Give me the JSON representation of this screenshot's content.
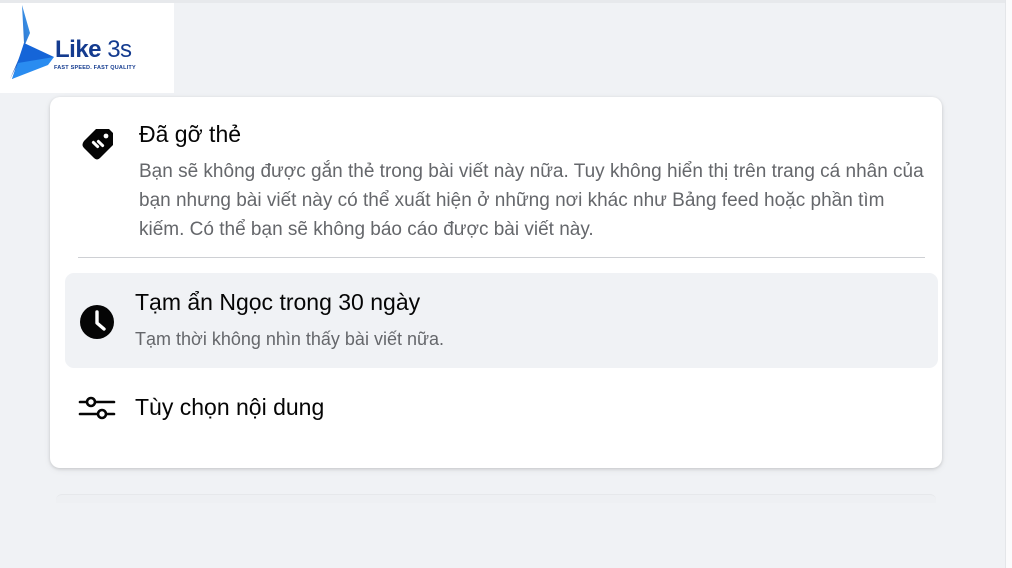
{
  "logo": {
    "wordmark": "Like",
    "wordmark_number": "3s",
    "tagline": "FAST SPEED. FAST QUALITY",
    "colors": {
      "primary": "#143b8f",
      "accent": "#1e88e5"
    }
  },
  "menu": {
    "items": [
      {
        "icon": "tag-removed-icon",
        "title": "Đã gỡ thẻ",
        "description": "Bạn sẽ không được gắn thẻ trong bài viết này nữa. Tuy không hiển thị trên trang cá nhân của bạn nhưng bài viết này có thể xuất hiện ở những nơi khác như Bảng feed hoặc phần tìm kiếm. Có thể bạn sẽ không báo cáo được bài viết này."
      },
      {
        "icon": "clock-icon",
        "title": "Tạm ẩn Ngọc trong 30 ngày",
        "description": "Tạm thời không nhìn thấy bài viết nữa.",
        "highlighted": true
      },
      {
        "icon": "sliders-icon",
        "title": "Tùy chọn nội dung"
      }
    ]
  },
  "colors": {
    "page_background": "#f0f2f5",
    "card_background": "#ffffff",
    "title_text": "#050505",
    "secondary_text": "#65676b",
    "hover_background": "#f0f2f5"
  }
}
